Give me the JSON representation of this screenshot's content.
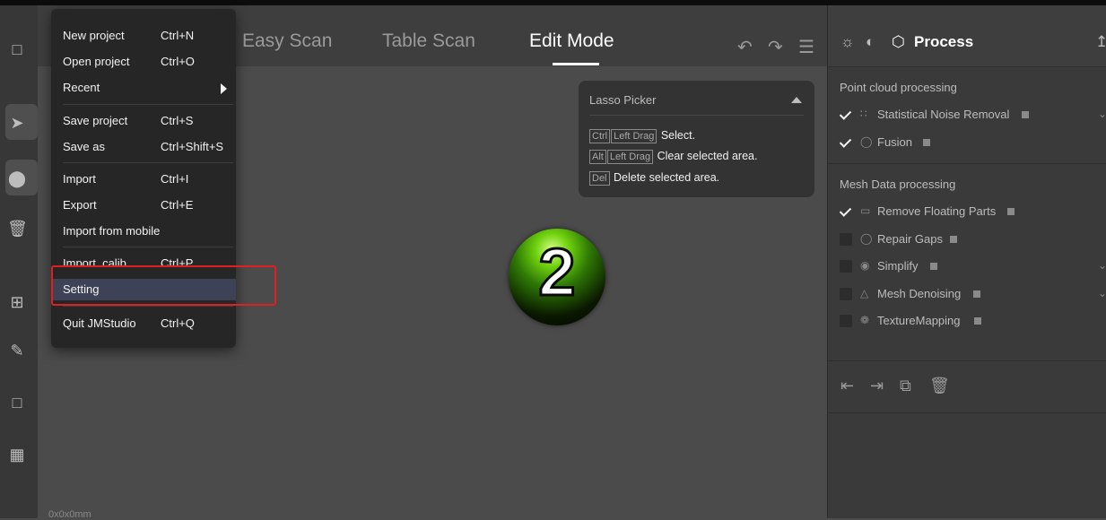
{
  "tabs": [
    {
      "label": "Easy Scan",
      "active": false
    },
    {
      "label": "Table Scan",
      "active": false
    },
    {
      "label": "Edit Mode",
      "active": true
    }
  ],
  "header_icons": [
    "undo-icon",
    "redo-icon",
    "menu-icon"
  ],
  "sidebar_icons": [
    "frame-icon",
    "select-icon",
    "lasso-select-icon",
    "delete-icon",
    "add-icon",
    "pencil-icon",
    "box-icon",
    "checker-icon"
  ],
  "file_menu": {
    "items": [
      {
        "label": "New project",
        "shortcut": "Ctrl+N"
      },
      {
        "label": "Open project",
        "shortcut": "Ctrl+O"
      },
      {
        "label": "Recent",
        "shortcut": "",
        "submenu": true
      },
      {
        "label": "Save project",
        "shortcut": "Ctrl+S"
      },
      {
        "label": "Save as",
        "shortcut": "Ctrl+Shift+S"
      },
      {
        "label": "Import",
        "shortcut": "Ctrl+I"
      },
      {
        "label": "Export",
        "shortcut": "Ctrl+E"
      },
      {
        "label": "Import from mobile",
        "shortcut": ""
      },
      {
        "label": "Import_calib",
        "shortcut": "Ctrl+P"
      },
      {
        "label": "Setting",
        "shortcut": "",
        "highlighted": true
      },
      {
        "label": "Quit JMStudio",
        "shortcut": "Ctrl+Q"
      }
    ]
  },
  "lasso_picker": {
    "title": "Lasso Picker",
    "rows": [
      {
        "keys": [
          "Ctrl",
          "Left Drag"
        ],
        "text": "Select."
      },
      {
        "keys": [
          "Alt",
          "Left Drag"
        ],
        "text": "Clear selected area."
      },
      {
        "keys": [
          "Del"
        ],
        "text": "Delete selected area."
      }
    ]
  },
  "step_badge": "2",
  "status_text": "0x0x0mm",
  "process_panel": {
    "title": "Process",
    "sections": [
      {
        "title": "Point cloud processing",
        "items": [
          {
            "label": "Statistical Noise Removal",
            "checked": true,
            "icon": "noise-icon",
            "expandable": true
          },
          {
            "label": "Fusion",
            "checked": true,
            "icon": "fusion-icon",
            "expandable": false
          }
        ]
      },
      {
        "title": "Mesh Data processing",
        "items": [
          {
            "label": "Remove Floating Parts",
            "checked": true,
            "icon": "floating-icon",
            "expandable": false
          },
          {
            "label": "Repair Gaps",
            "checked": false,
            "icon": "repair-icon",
            "expandable": false
          },
          {
            "label": "Simplify",
            "checked": false,
            "icon": "simplify-icon",
            "expandable": true
          },
          {
            "label": "Mesh Denoising",
            "checked": false,
            "icon": "denoise-icon",
            "expandable": true
          },
          {
            "label": "TextureMapping",
            "checked": false,
            "icon": "texture-icon",
            "expandable": false
          }
        ]
      }
    ],
    "bottom_icons": [
      "import-icon",
      "export-icon",
      "copy-icon",
      "trash-icon"
    ]
  },
  "colors": {
    "highlight_box": "#e02020",
    "menu_highlight": "#3e4257"
  }
}
